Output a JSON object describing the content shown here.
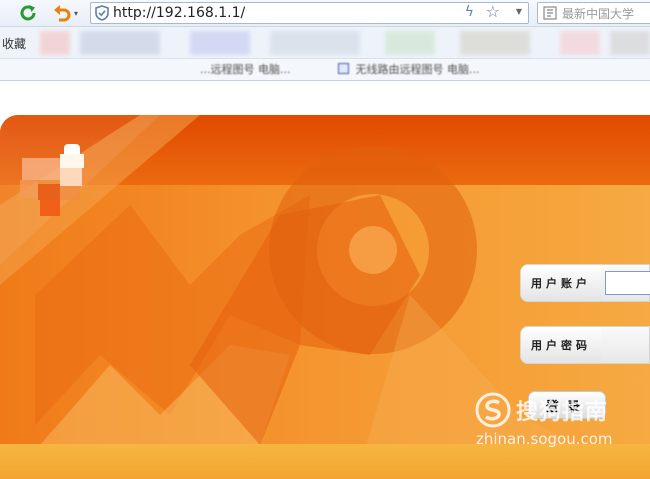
{
  "browser": {
    "address_bar": {
      "url": "http://192.168.1.1/"
    },
    "search_box": {
      "placeholder": "最新中国大学"
    },
    "favorites_bar": {
      "label": "收藏"
    },
    "tabs": [
      {
        "label": "...远程图号 电脑..."
      },
      {
        "label": "无线路由远程图号 电脑..."
      }
    ]
  },
  "login": {
    "username_label": "用户账户",
    "password_label": "用户密码",
    "submit_label": "登录"
  },
  "watermark": {
    "title": "搜狗指南",
    "url": "zhinan.sogou.com"
  },
  "colors": {
    "banner_orange": "#f07a18",
    "banner_top": "#e04a00",
    "accent_blue": "#7a9bd6"
  }
}
